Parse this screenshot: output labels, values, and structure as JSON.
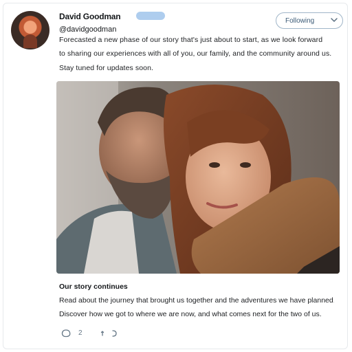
{
  "author": {
    "display_name": "David Goodman",
    "verified_label": "",
    "handle": "@davidgoodman"
  },
  "follow_button": {
    "label": "Following"
  },
  "tweet": {
    "lines": [
      "Forecasted a new phase of our story that's just about to start, as we look forward",
      "to sharing our experiences with all of you, our family, and the community around us.",
      "Stay tuned for updates soon."
    ]
  },
  "link_card": {
    "title": "Our story continues",
    "description_lines": [
      "Read about the journey that brought us together and the adventures we have planned.",
      "Discover how we got to where we are now, and what comes next for the two of us."
    ]
  },
  "actions": {
    "reply_count": "2",
    "icons": [
      "reply-icon",
      "retweet-icon",
      "like-icon"
    ]
  },
  "colors": {
    "accent": "#1da1f2",
    "follow_border": "#9fb5c8",
    "text": "#14171a"
  }
}
